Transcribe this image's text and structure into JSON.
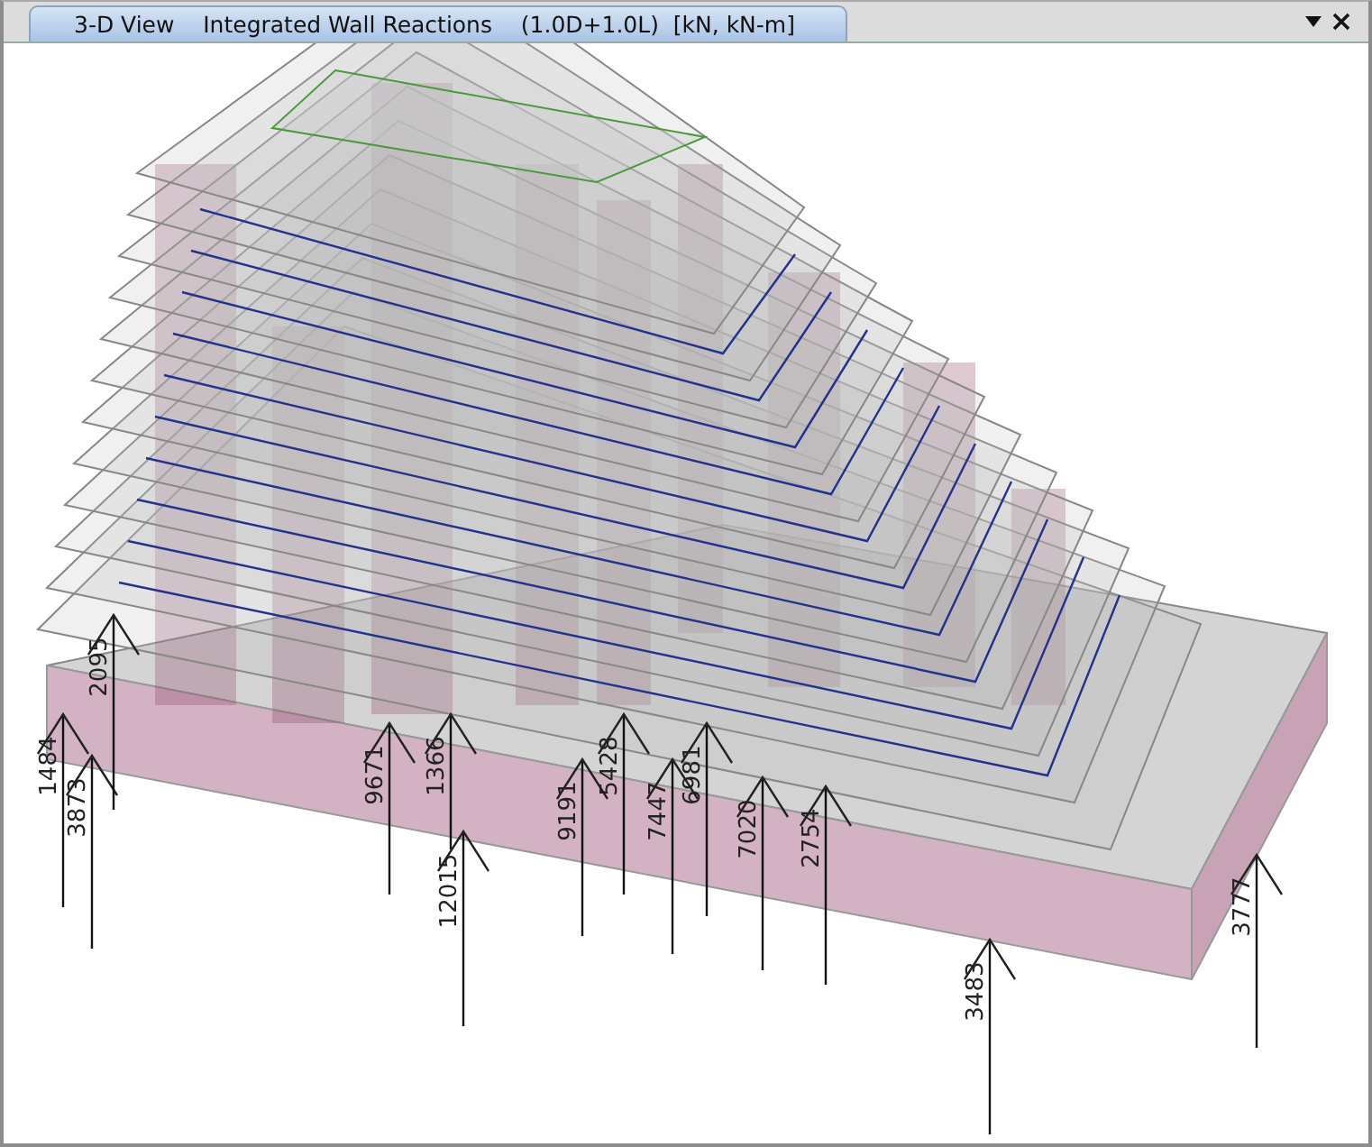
{
  "window": {
    "tab": {
      "label": "3-D View    Integrated Wall Reactions    (1.0D+1.0L)  [kN, kN-m]",
      "selected": true
    }
  },
  "reactions": [
    {
      "value": "1484"
    },
    {
      "value": "3873"
    },
    {
      "value": "2095"
    },
    {
      "value": "9671"
    },
    {
      "value": "1366"
    },
    {
      "value": "12015"
    },
    {
      "value": "9191"
    },
    {
      "value": "5428"
    },
    {
      "value": "7447"
    },
    {
      "value": "6981"
    },
    {
      "value": "7020"
    },
    {
      "value": "2754"
    },
    {
      "value": "3483"
    },
    {
      "value": "3777"
    }
  ]
}
